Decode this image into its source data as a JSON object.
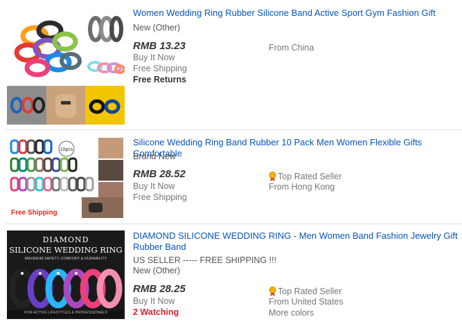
{
  "listings": [
    {
      "title": "Women Wedding Ring Rubber Silicone Band Active Sport Gym Fashion Gift",
      "condition": "New (Other)",
      "price": "RMB 13.23",
      "format": "Buy It Now",
      "shipping": "Free Shipping",
      "returns": "Free Returns",
      "location": "From China"
    },
    {
      "title": "Silicone Wedding Ring Band Rubber 10 Pack Men Women Flexible Gifts Comfortable",
      "condition": "Brand New",
      "price": "RMB 28.52",
      "format": "Buy It Now",
      "shipping": "Free Shipping",
      "seller_badge": "Top Rated Seller",
      "location": "From Hong Kong",
      "image_text": {
        "free_shipping": "Free Shipping",
        "pack": "10pcs"
      }
    },
    {
      "title": "DIAMOND SILICONE WEDDING RING - Men Women Band Fashion Jewelry Gift Rubber Band",
      "subtitle": "US SELLER ----- FREE SHIPPING !!!",
      "condition": "New (Other)",
      "price": "RMB 28.25",
      "format": "Buy It Now",
      "watching": "2 Watching",
      "seller_badge": "Top Rated Seller",
      "location": "From United States",
      "more": "More colors",
      "image_text": {
        "line1": "DIAMOND",
        "line2": "SILICONE WEDDING RING",
        "line3": "MAXIMUM SAFETY, COMFORT & DURABILITY",
        "footer": "FOR ACTIVE LIFESTYLES & PROFESSIONALS"
      }
    }
  ],
  "colors": {
    "link": "#0654ba",
    "watching": "#dd1e31",
    "muted": "#767676"
  }
}
